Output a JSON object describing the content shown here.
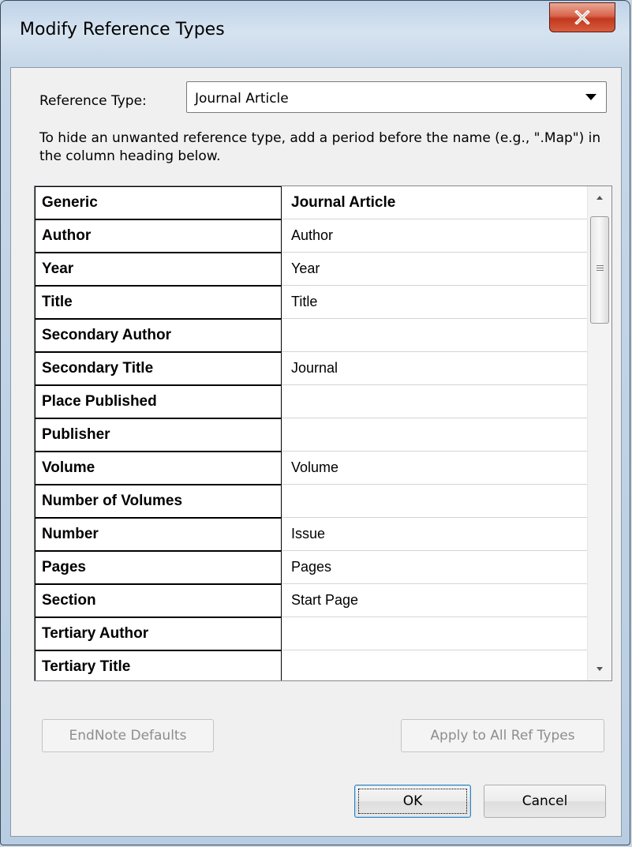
{
  "window": {
    "title": "Modify Reference Types",
    "close_icon": "close-x-icon"
  },
  "reference_type": {
    "label": "Reference Type:",
    "selected": "Journal Article"
  },
  "instructions": "To hide an unwanted reference type, add a period before the name (e.g., \".Map\") in the column heading below.",
  "grid": {
    "rows": [
      {
        "name": "Generic",
        "value": "Journal Article"
      },
      {
        "name": "Author",
        "value": "Author"
      },
      {
        "name": "Year",
        "value": "Year"
      },
      {
        "name": "Title",
        "value": "Title"
      },
      {
        "name": "Secondary Author",
        "value": ""
      },
      {
        "name": "Secondary Title",
        "value": "Journal"
      },
      {
        "name": "Place Published",
        "value": ""
      },
      {
        "name": "Publisher",
        "value": ""
      },
      {
        "name": "Volume",
        "value": "Volume"
      },
      {
        "name": "Number of Volumes",
        "value": ""
      },
      {
        "name": "Number",
        "value": "Issue"
      },
      {
        "name": "Pages",
        "value": "Pages"
      },
      {
        "name": "Section",
        "value": "Start Page"
      },
      {
        "name": "Tertiary Author",
        "value": ""
      },
      {
        "name": "Tertiary Title",
        "value": ""
      }
    ]
  },
  "buttons": {
    "endnote_defaults": "EndNote Defaults",
    "apply_all": "Apply to All Ref Types",
    "ok": "OK",
    "cancel": "Cancel"
  }
}
